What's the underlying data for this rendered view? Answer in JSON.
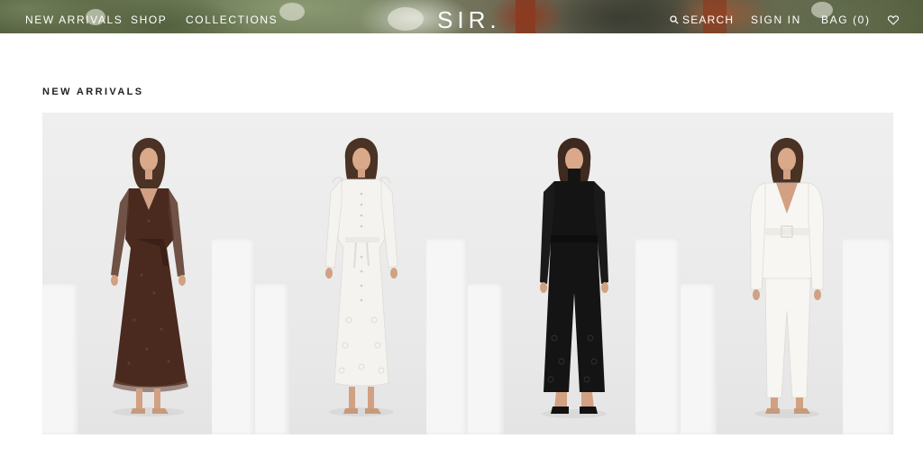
{
  "header": {
    "nav_left": [
      "NEW ARRIVALS",
      "SHOP",
      "COLLECTIONS"
    ],
    "logo": "SIR.",
    "search_label": "SEARCH",
    "sign_in_label": "SIGN IN",
    "bag_label": "BAG (0)",
    "icons": {
      "search": "search-icon",
      "wishlist": "heart-icon"
    }
  },
  "main": {
    "section_title": "NEW ARRIVALS",
    "products": [
      {
        "outfit": "brown-print-wrap-midi-dress",
        "color": "#4a2a1e"
      },
      {
        "outfit": "white-lace-button-midi-dress",
        "color": "#f4f3ef"
      },
      {
        "outfit": "black-knit-turtleneck-jumpsuit",
        "color": "#141414"
      },
      {
        "outfit": "white-wrap-blazer-and-trousers",
        "color": "#f7f6f2"
      }
    ]
  },
  "colors": {
    "header_text": "#ffffff",
    "title_text": "#222222",
    "page_background": "#ffffff",
    "card_background": "#ececec"
  }
}
